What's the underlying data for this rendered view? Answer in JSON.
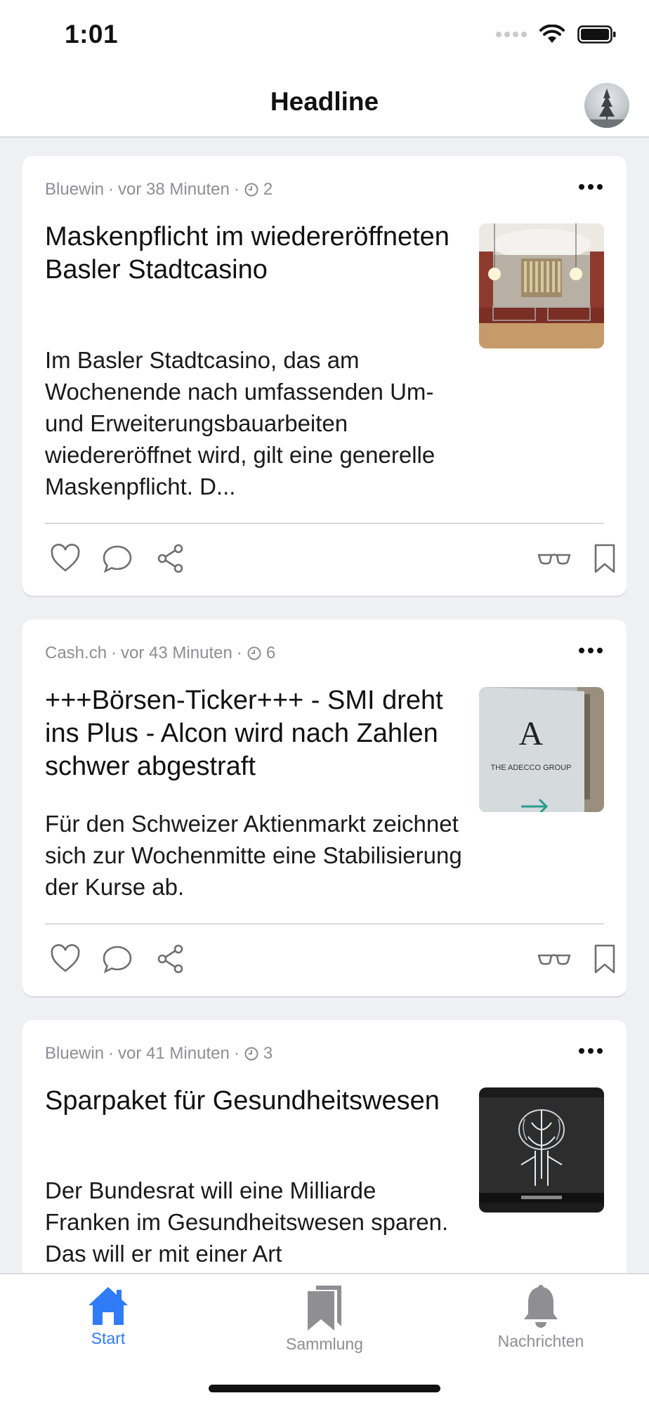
{
  "status_bar": {
    "time": "1:01"
  },
  "nav": {
    "title": "Headline"
  },
  "articles": [
    {
      "source": "Bluewin",
      "age": "vor 38 Minuten",
      "comments": "2",
      "title": "Maskenpflicht im wiedereröffneten Basler Stadtcasino",
      "body": "Im Basler Stadtcasino, das am Wochenende nach umfassenden Um- und Erweiterungsbauarbeiten wiedereröffnet wird, gilt eine generelle Maskenpflicht. D..."
    },
    {
      "source": "Cash.ch",
      "age": "vor 43 Minuten",
      "comments": "6",
      "title": "+++Börsen-Ticker+++ - SMI dreht ins Plus - Alcon wird nach Zahlen schwer abgestraft",
      "body": "Für den Schweizer Aktienmarkt zeichnet sich zur Wochenmitte eine Stabilisierung der Kurse ab.",
      "thumb_text": "THE ADECCO GROUP"
    },
    {
      "source": "Bluewin",
      "age": "vor 41 Minuten",
      "comments": "3",
      "title": "Sparpaket für Gesundheitswesen",
      "body": "Der Bundesrat will eine Milliarde Franken im Gesundheitswesen sparen. Das will er mit einer Art"
    }
  ],
  "tabs": [
    {
      "label": "Start",
      "icon": "home-icon",
      "active": true
    },
    {
      "label": "Sammlung",
      "icon": "bookmarks-icon",
      "active": false
    },
    {
      "label": "Nachrichten",
      "icon": "bell-icon",
      "active": false
    }
  ],
  "colors": {
    "accent": "#2f7cf6",
    "inactive": "#8e8e93"
  }
}
